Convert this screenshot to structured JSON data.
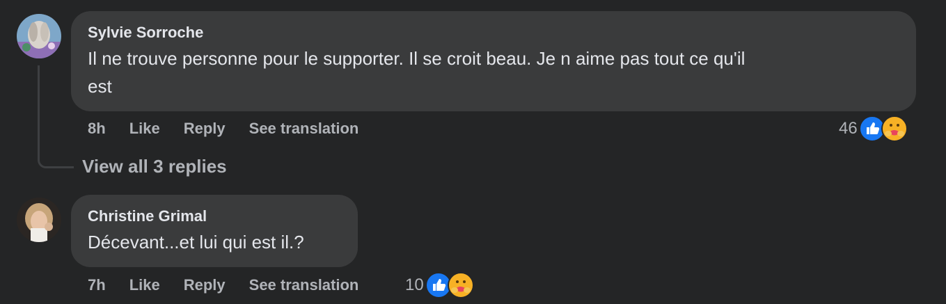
{
  "comments": [
    {
      "author": "Sylvie Sorroche",
      "text_line1": "Il ne trouve personne pour le supporter. Il se croit beau. Je n aime pas tout ce qu'il",
      "text_line2": "est",
      "time": "8h",
      "like_label": "Like",
      "reply_label": "Reply",
      "translate_label": "See translation",
      "reaction_count": "46"
    },
    {
      "author": "Christine Grimal",
      "text_line1": "Décevant...et lui qui est il.?",
      "time": "7h",
      "like_label": "Like",
      "reply_label": "Reply",
      "translate_label": "See translation",
      "reaction_count": "10"
    }
  ],
  "view_replies_label": "View all 3 replies",
  "icons": {
    "like_reaction": "like-reaction-icon",
    "care_reaction": "care-reaction-icon"
  },
  "colors": {
    "background": "#242526",
    "bubble": "#3a3b3c",
    "primary_text": "#e4e6eb",
    "secondary_text": "#b0b3b8",
    "like_blue": "#1877f2"
  }
}
